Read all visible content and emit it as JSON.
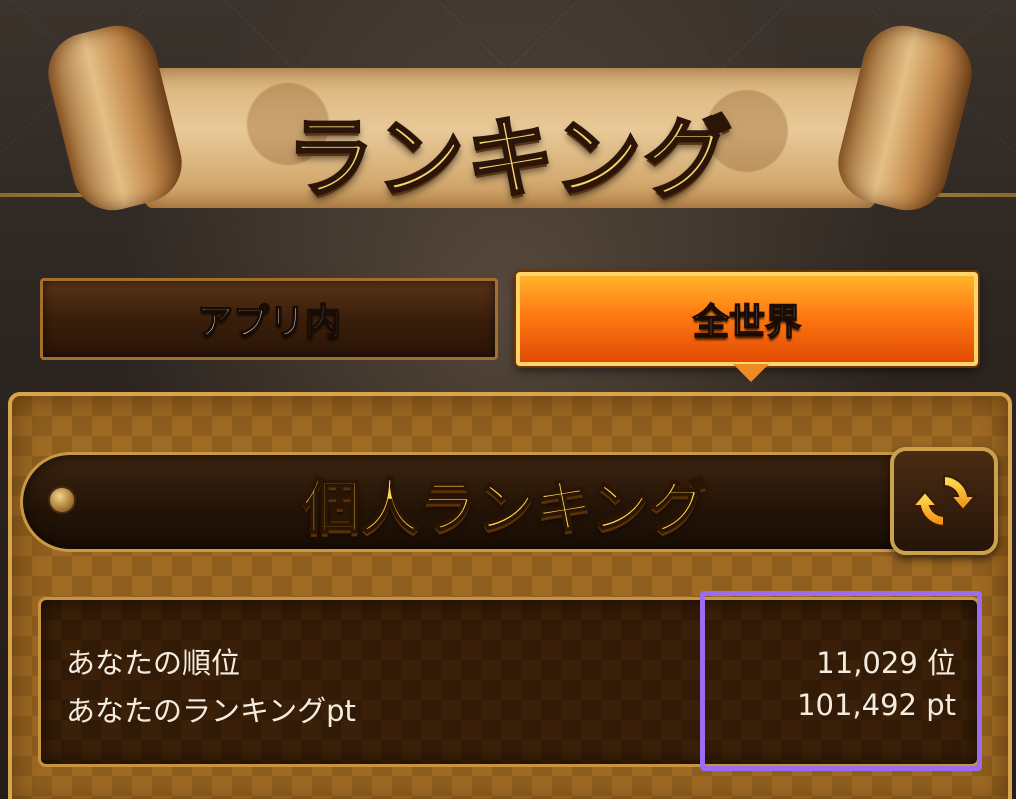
{
  "screen": {
    "title": "ランキング"
  },
  "tabs": [
    {
      "label": "アプリ内",
      "active": false
    },
    {
      "label": "全世界",
      "active": true
    }
  ],
  "panel": {
    "header_title": "個人ランキング",
    "refresh_icon": "refresh-icon"
  },
  "stats": {
    "rank_label": "あなたの順位",
    "rank_value": "11,029 位",
    "points_label": "あなたのランキングpt",
    "points_value": "101,492 pt"
  },
  "colors": {
    "accent_gold": "#ffd84a",
    "active_tab": "#ff7a12",
    "highlight": "#9b6cf0"
  }
}
